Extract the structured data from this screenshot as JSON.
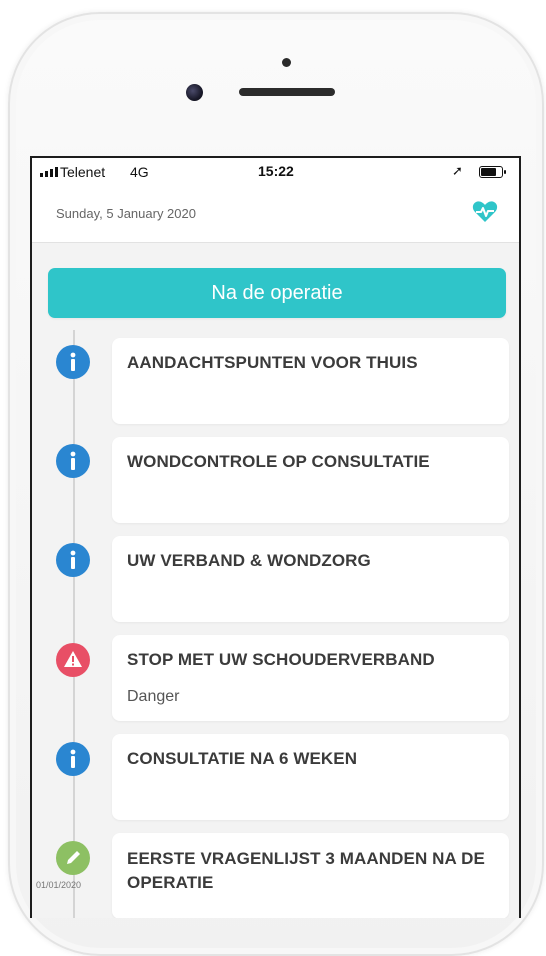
{
  "status_bar": {
    "carrier": "Telenet",
    "network": "4G",
    "time": "15:22",
    "location_icon": "location-arrow-icon",
    "battery_icon": "battery-icon"
  },
  "header": {
    "date": "Sunday, 5 January 2020",
    "icon": "heart-pulse-icon",
    "accent_color": "#2fc5c9"
  },
  "section": {
    "label": "Na de operatie"
  },
  "timeline": [
    {
      "type": "info",
      "icon": "info-icon",
      "title": "AANDACHTSPUNTEN VOOR THUIS",
      "subtitle": ""
    },
    {
      "type": "info",
      "icon": "info-icon",
      "title": "WONDCONTROLE OP CONSULTATIE",
      "subtitle": ""
    },
    {
      "type": "info",
      "icon": "info-icon",
      "title": "UW VERBAND & WONDZORG",
      "subtitle": ""
    },
    {
      "type": "danger",
      "icon": "warning-icon",
      "title": "STOP MET UW SCHOUDERVERBAND",
      "subtitle": "Danger"
    },
    {
      "type": "info",
      "icon": "info-icon",
      "title": "CONSULTATIE NA 6 WEKEN",
      "subtitle": ""
    },
    {
      "type": "edit",
      "icon": "pencil-icon",
      "title": "EERSTE VRAGENLIJST 3 MAANDEN NA DE OPERATIE",
      "subtitle": "",
      "date": "01/01/2020"
    }
  ],
  "colors": {
    "info": "#2a86d1",
    "danger": "#e84f66",
    "edit": "#8dc063"
  }
}
